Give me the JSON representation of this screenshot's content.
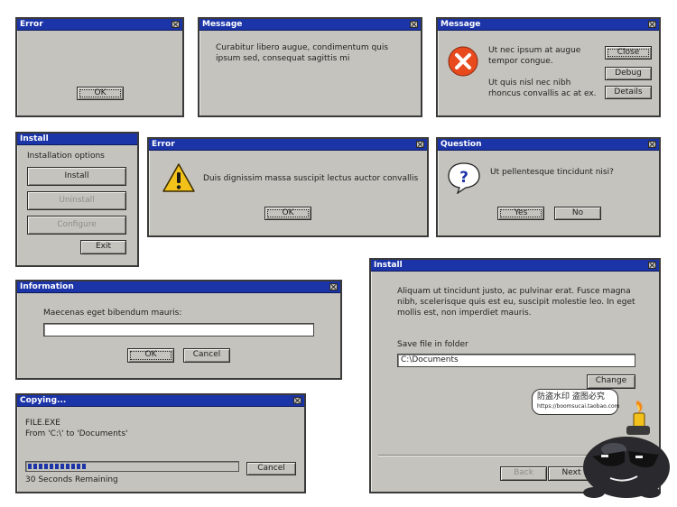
{
  "error1": {
    "title": "Error",
    "ok": "OK"
  },
  "message1": {
    "title": "Message",
    "text": "Curabitur libero augue, condimentum quis ipsum sed, consequat sagittis mi"
  },
  "message2": {
    "title": "Message",
    "text1": "Ut nec ipsum at augue tempor congue.",
    "text2": "Ut quis nisl nec nibh rhoncus convallis ac at ex.",
    "buttons": [
      "Close",
      "Debug",
      "Details"
    ],
    "icon": "error-circle-icon"
  },
  "install_small": {
    "title": "Install",
    "heading": "Installation options",
    "buttons": [
      "Install",
      "Uninstall",
      "Configure"
    ],
    "exit": "Exit"
  },
  "error2": {
    "title": "Error",
    "text": "Duis dignissim massa suscipit lectus auctor convallis",
    "ok": "OK",
    "icon": "warning-triangle-icon"
  },
  "question": {
    "title": "Question",
    "text": "Ut pellentesque tincidunt nisi?",
    "yes": "Yes",
    "no": "No",
    "icon": "question-bubble-icon"
  },
  "information": {
    "title": "Information",
    "label": "Maecenas eget bibendum mauris:",
    "input_value": "",
    "ok": "OK",
    "cancel": "Cancel"
  },
  "install_large": {
    "title": "Install",
    "text": "Aliquam ut tincidunt justo, ac pulvinar erat. Fusce magna nibh, scelerisque quis est eu, suscipit molestie leo. In eget mollis est, non imperdiet mauris.",
    "folder_label": "Save file in folder",
    "folder_value": "C:\\Documents",
    "change": "Change",
    "back": "Back",
    "next": "Next"
  },
  "copying": {
    "title": "Copying...",
    "file": "FILE.EXE",
    "from_to": "From 'C:\\' to 'Documents'",
    "remaining": "30 Seconds Remaining",
    "cancel": "Cancel",
    "progress": 0.3
  },
  "watermark": {
    "text": "防盗水印 盗图必究",
    "url": "https://boomsucai.taobao.com"
  },
  "colors": {
    "titlebar": "#1b34a8",
    "window": "#c4c3bd",
    "progress": "#1b34a8"
  }
}
